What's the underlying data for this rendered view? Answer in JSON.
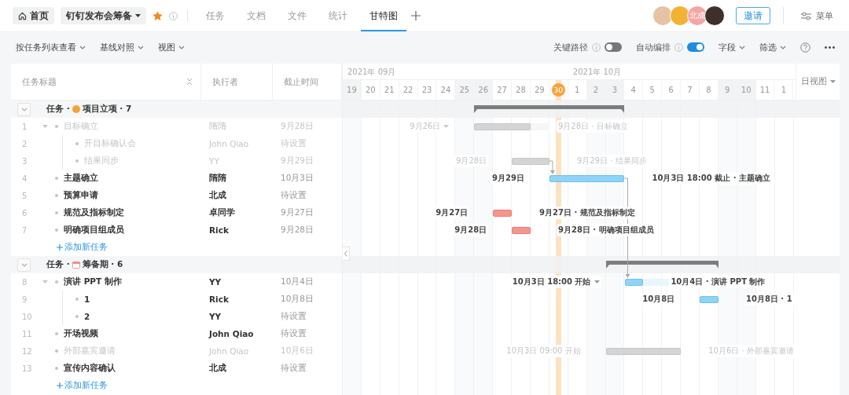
{
  "top_bar": {
    "home": "首页",
    "project": "钉钉发布会筹备",
    "starred": true,
    "tabs": [
      {
        "label": "任务",
        "selected": false
      },
      {
        "label": "文档",
        "selected": false
      },
      {
        "label": "文件",
        "selected": false
      },
      {
        "label": "统计",
        "selected": false
      },
      {
        "label": "甘特图",
        "selected": true
      }
    ],
    "members": [
      {
        "color": "#e6c3a3"
      },
      {
        "color": "#f2b233"
      },
      {
        "color": "#f3a6a6",
        "initials": "北成"
      },
      {
        "color": "#3b302b"
      }
    ],
    "invite": "邀请",
    "menu": "菜单"
  },
  "toolbar": {
    "menus": [
      {
        "label": "按任务列表查看"
      },
      {
        "label": "基线对照"
      },
      {
        "label": "视图"
      }
    ],
    "switches": [
      {
        "label": "关键路径",
        "on": false
      },
      {
        "label": "自动编排",
        "on": true
      }
    ],
    "dropdowns": [
      {
        "label": "字段"
      },
      {
        "label": "筛选"
      }
    ]
  },
  "table": {
    "columns": [
      "任务标题",
      "执行者",
      "截止时间"
    ],
    "groups": [
      {
        "prefix": "任务 ·",
        "label": "项目立项 · 7",
        "expanded": true,
        "add_label": "添加新任务",
        "tasks": [
          {
            "number": "1",
            "title": "目标确立",
            "assignee": "隋隋",
            "due": "9月28日",
            "done": true,
            "expanded": true,
            "bar": {
              "start_label": "9月26日",
              "end_label": "9月28日 · 目标确立"
            },
            "children": [
              {
                "number": "2",
                "title": "开目标确认会",
                "assignee": "John Qiao",
                "due": "待设置",
                "done": true
              },
              {
                "number": "3",
                "title": "结果同步",
                "assignee": "YY",
                "due": "9月29日",
                "done": true,
                "bar": {
                  "start_label": "9月28日",
                  "end_label": "9月29日 · 结果同步"
                }
              }
            ]
          },
          {
            "number": "4",
            "title": "主题确立",
            "assignee": "隋隋",
            "due": "10月3日",
            "done": false,
            "bar": {
              "overdue": false,
              "start_label": "9月29日",
              "end_label": "10月3日 18:00 截止 · 主题确立"
            }
          },
          {
            "number": "5",
            "title": "预算申请",
            "assignee": "北成",
            "due": "待设置",
            "done": false
          },
          {
            "number": "6",
            "title": "规范及指标制定",
            "assignee": "卓同学",
            "due": "9月27日",
            "done": false,
            "bar": {
              "overdue": true,
              "start_label": "9月27日",
              "end_label": "9月27日 · 规范及指标制定"
            }
          },
          {
            "number": "7",
            "title": "明确项目组成员",
            "assignee": "Rick",
            "due": "9月28日",
            "done": false,
            "bar": {
              "overdue": true,
              "start_label": "9月28日",
              "end_label": "9月28日 · 明确项目组成员"
            }
          }
        ]
      },
      {
        "prefix": "任务 ·",
        "label": "筹备期 · 6",
        "expanded": true,
        "add_label": "添加新任务",
        "tasks": [
          {
            "number": "8",
            "title": "演讲 PPT 制作",
            "assignee": "YY",
            "due": "10月4日",
            "done": false,
            "expanded": true,
            "bar": {
              "overdue": false,
              "start_label": "10月3日 18:00 开始",
              "end_label": "10月4日 · 演讲 PPT 制作"
            },
            "children": [
              {
                "number": "9",
                "title": "1",
                "assignee": "Rick",
                "due": "10月8日",
                "done": false,
                "bar": {
                  "overdue": false,
                  "start_label": "10月8日",
                  "end_label": "10月8日 · 1"
                }
              },
              {
                "number": "10",
                "title": "2",
                "assignee": "YY",
                "due": "待设置",
                "done": false
              }
            ]
          },
          {
            "number": "11",
            "title": "开场视频",
            "assignee": "John Qiao",
            "due": "待设置",
            "done": false
          },
          {
            "number": "12",
            "title": "外部嘉宾邀请",
            "assignee": "John Qiao",
            "due": "10月6日",
            "done": true,
            "bar": {
              "start_label": "10月3日 09:00 开始",
              "end_label": "10月6日 · 外部嘉宾邀请"
            }
          },
          {
            "number": "13",
            "title": "宣传内容确认",
            "assignee": "北成",
            "due": "待设置",
            "done": false
          }
        ]
      }
    ]
  },
  "gantt": {
    "months": [
      "2021年 09月",
      "2021年 10月"
    ],
    "view": "日视图",
    "days": [
      {
        "label": "19",
        "weekend": true,
        "today": false
      },
      {
        "label": "20",
        "weekend": false,
        "today": false
      },
      {
        "label": "21",
        "weekend": false,
        "today": false
      },
      {
        "label": "22",
        "weekend": false,
        "today": false
      },
      {
        "label": "23",
        "weekend": false,
        "today": false
      },
      {
        "label": "24",
        "weekend": false,
        "today": false
      },
      {
        "label": "25",
        "weekend": true,
        "today": false
      },
      {
        "label": "26",
        "weekend": true,
        "today": false
      },
      {
        "label": "27",
        "weekend": false,
        "today": false
      },
      {
        "label": "28",
        "weekend": false,
        "today": false
      },
      {
        "label": "29",
        "weekend": false,
        "today": false
      },
      {
        "label": "30",
        "weekend": false,
        "today": true
      },
      {
        "label": "1",
        "weekend": false,
        "today": false
      },
      {
        "label": "2",
        "weekend": true,
        "today": false
      },
      {
        "label": "3",
        "weekend": true,
        "today": false
      },
      {
        "label": "4",
        "weekend": false,
        "today": false
      },
      {
        "label": "5",
        "weekend": false,
        "today": false
      },
      {
        "label": "6",
        "weekend": false,
        "today": false
      },
      {
        "label": "7",
        "weekend": false,
        "today": false
      },
      {
        "label": "8",
        "weekend": false,
        "today": false
      },
      {
        "label": "9",
        "weekend": true,
        "today": false
      },
      {
        "label": "10",
        "weekend": true,
        "today": false
      },
      {
        "label": "11",
        "weekend": false,
        "today": false
      },
      {
        "label": "1",
        "weekend": false,
        "today": false
      }
    ]
  }
}
